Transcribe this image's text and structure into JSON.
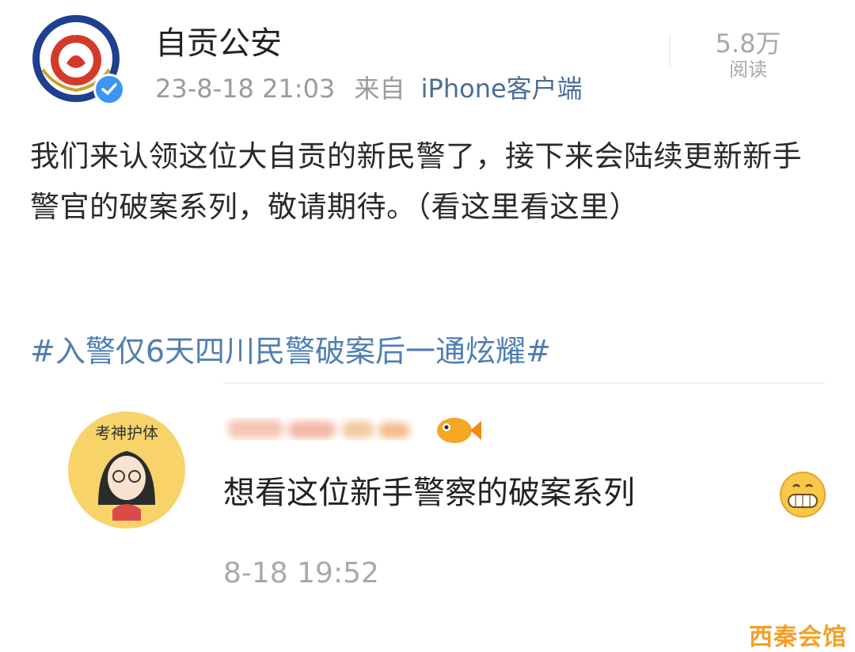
{
  "post": {
    "account_name": "自贡公安",
    "badge_text": "自贡公安",
    "time": "23-8-18 21:03",
    "source_prefix": "来自",
    "source": "iPhone客户端",
    "reads_count": "5.8万",
    "reads_label": "阅读",
    "text": "我们来认领这位大自贡的新民警了，接下来会陆续更新新手警官的破案系列，敬请期待。（看这里看这里）",
    "topic": "#入警仅6天四川民警破案后一通炫耀#"
  },
  "comment": {
    "avatar_caption": "考神护体",
    "text": "想看这位新手警察的破案系列",
    "time": "8-18 19:52"
  },
  "watermark": "西秦会馆",
  "colors": {
    "link": "#4f7fb0",
    "verified": "#3c95f0",
    "muted": "#9b9b9b",
    "watermark": "#f0a02a"
  }
}
